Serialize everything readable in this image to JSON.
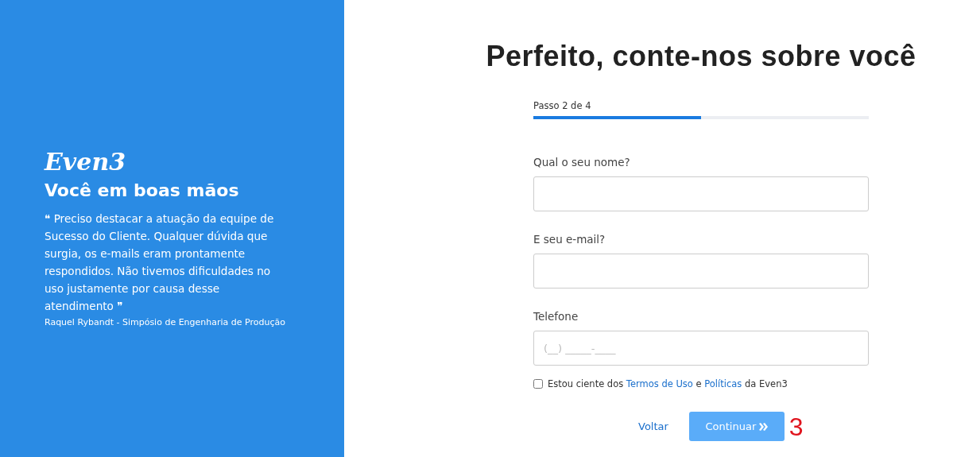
{
  "sidebar": {
    "logo": "Even3",
    "heading": "Você em boas mãos",
    "quote": "❝ Preciso destacar a atuação da equipe de Sucesso do Cliente. Qualquer dúvida que surgia, os e-mails eram prontamente respondidos. Não tivemos dificuldades no uso justamente por causa desse atendimento ❞",
    "author": "Raquel Rybandt - Simpósio de Engenharia de Produção"
  },
  "title": "Perfeito, conte-nos sobre você",
  "progress": {
    "label": "Passo 2 de 4",
    "level": 0.5
  },
  "fields": [
    {
      "label": "Qual o seu nome?"
    },
    {
      "label": "E seu e-mail?"
    },
    {
      "label": "Telefone",
      "placeholder": "(__) _____-____"
    }
  ],
  "consent": {
    "checked": false,
    "parts": [
      {
        "kind": "text",
        "text": "Estou ciente dos"
      },
      {
        "kind": "link",
        "text": "Termos de Uso"
      },
      {
        "kind": "text",
        "text": "e"
      },
      {
        "kind": "link",
        "text": "Políticas"
      },
      {
        "kind": "text",
        "text": "da Even3"
      }
    ]
  },
  "actions": {
    "back": "Voltar",
    "continue": "Continuar"
  },
  "annotation": "3"
}
